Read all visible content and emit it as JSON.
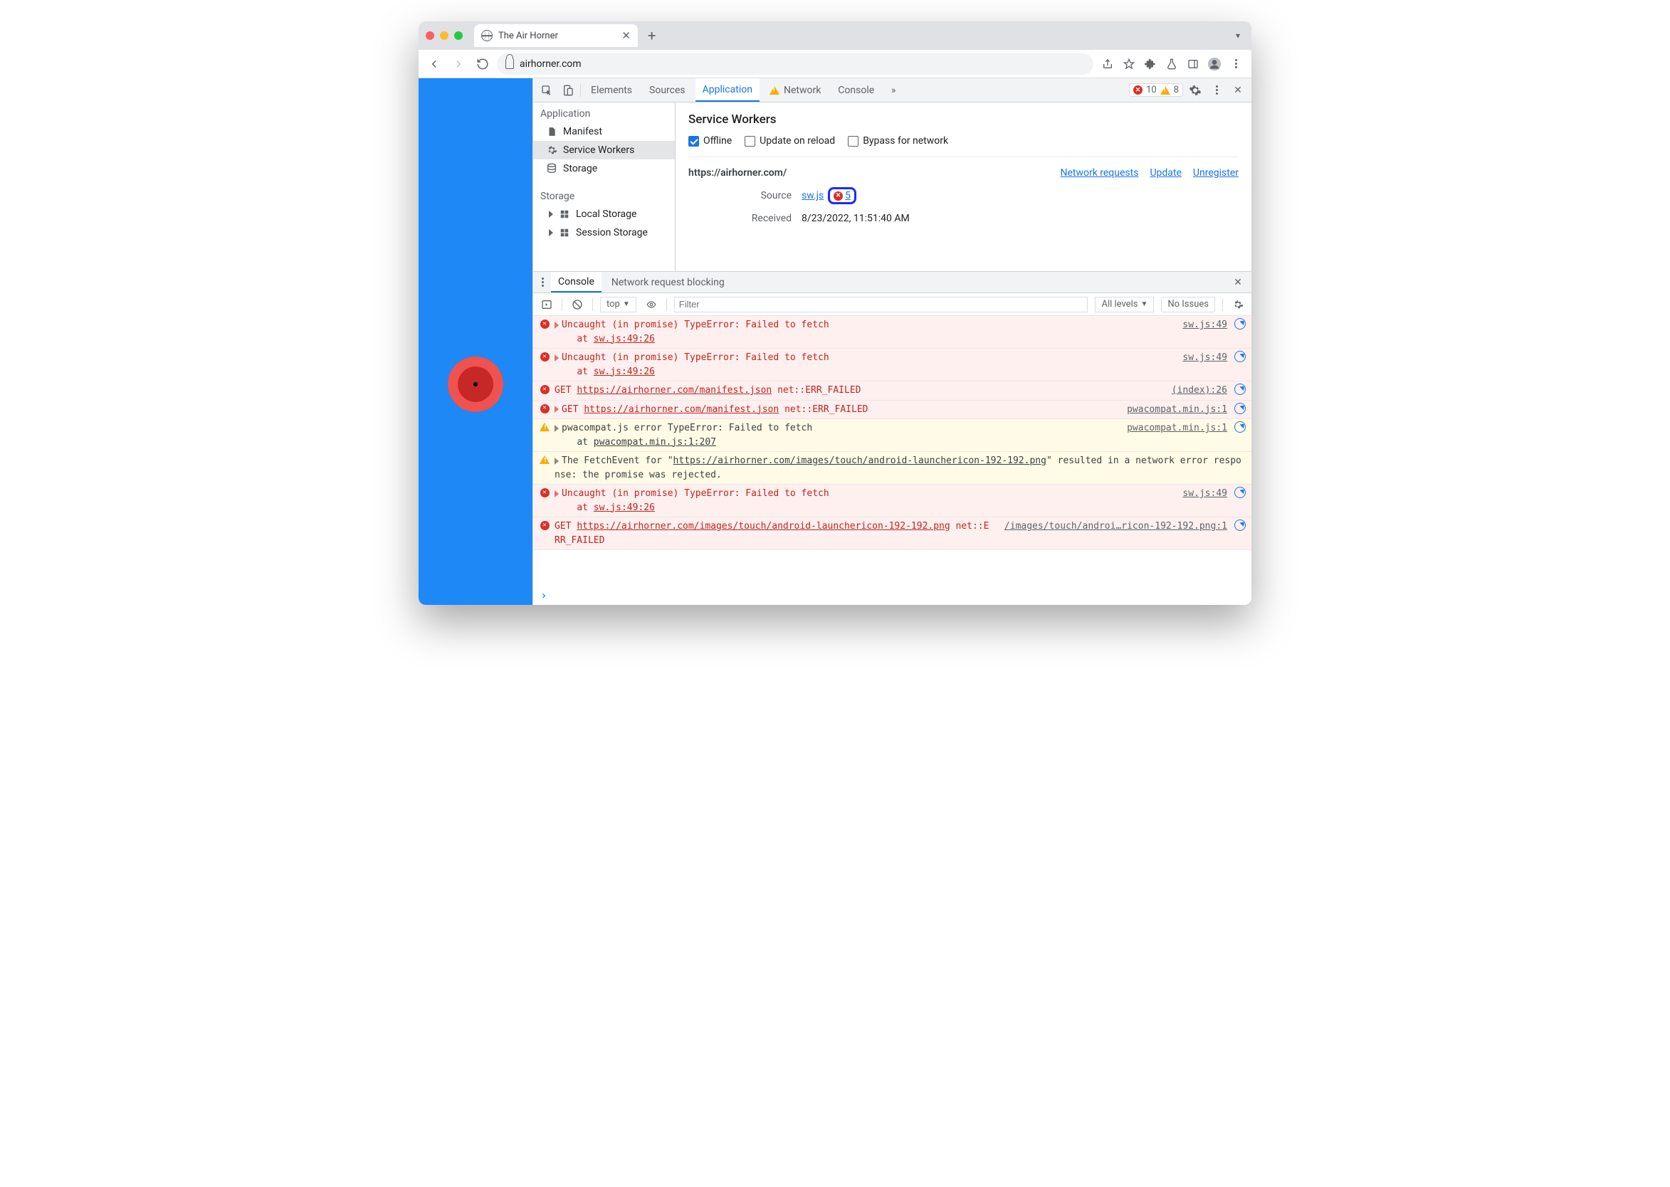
{
  "tab": {
    "title": "The Air Horner"
  },
  "omnibox": {
    "url": "airhorner.com"
  },
  "devtools": {
    "tabs": [
      "Elements",
      "Sources",
      "Application",
      "Network",
      "Console"
    ],
    "activeTab": "Application",
    "errorCount": "10",
    "warnCount": "8"
  },
  "sidebar": {
    "sec1": "Application",
    "manifest": "Manifest",
    "sw": "Service Workers",
    "storage": "Storage",
    "sec2": "Storage",
    "local": "Local Storage",
    "session": "Session Storage"
  },
  "sw": {
    "title": "Service Workers",
    "offline": "Offline",
    "update": "Update on reload",
    "bypass": "Bypass for network",
    "origin": "https://airhorner.com/",
    "link_netreq": "Network requests",
    "link_update": "Update",
    "link_unreg": "Unregister",
    "source_k": "Source",
    "source_v": "sw.js",
    "source_errcount": "5",
    "received_k": "Received",
    "received_v": "8/23/2022, 11:51:40 AM"
  },
  "drawer": {
    "tabs": {
      "console": "Console",
      "blocking": "Network request blocking"
    },
    "ctx": "top",
    "filter_ph": "Filter",
    "levels": "All levels",
    "issues": "No Issues"
  },
  "console": [
    {
      "t": "err",
      "expand": true,
      "msg": "Uncaught (in promise) TypeError: Failed to fetch\n    at ",
      "msg_link": "sw.js:49:26",
      "src": "sw.js:49"
    },
    {
      "t": "err",
      "expand": true,
      "msg": "Uncaught (in promise) TypeError: Failed to fetch\n    at ",
      "msg_link": "sw.js:49:26",
      "src": "sw.js:49"
    },
    {
      "t": "err",
      "expand": false,
      "prefix": "GET ",
      "url": "https://airhorner.com/manifest.json",
      "suffix": " net::ERR_FAILED",
      "src": "(index):26"
    },
    {
      "t": "err",
      "expand": true,
      "prefix": "GET ",
      "url": "https://airhorner.com/manifest.json",
      "suffix": " net::ERR_FAILED",
      "src": "pwacompat.min.js:1"
    },
    {
      "t": "wrn",
      "expand": true,
      "msg": "pwacompat.js error TypeError: Failed to fetch\n    at ",
      "msg_link": "pwacompat.min.js:1:207",
      "src": "pwacompat.min.js:1"
    },
    {
      "t": "wrn",
      "expand": true,
      "msg": "The FetchEvent for \"",
      "url": "https://airhorner.com/images/touch/android-launchericon-192-192.png",
      "suffix": "\" resulted in a network error response: the promise was rejected.",
      "src": ""
    },
    {
      "t": "err",
      "expand": true,
      "msg": "Uncaught (in promise) TypeError: Failed to fetch\n    at ",
      "msg_link": "sw.js:49:26",
      "src": "sw.js:49"
    },
    {
      "t": "err",
      "expand": false,
      "prefix": "GET ",
      "url": "https://airhorner.com/images/touch/android-launchericon-192-192.png",
      "suffix": " net::ERR_FAILED",
      "src": "/images/touch/androi…ricon-192-192.png:1"
    }
  ]
}
